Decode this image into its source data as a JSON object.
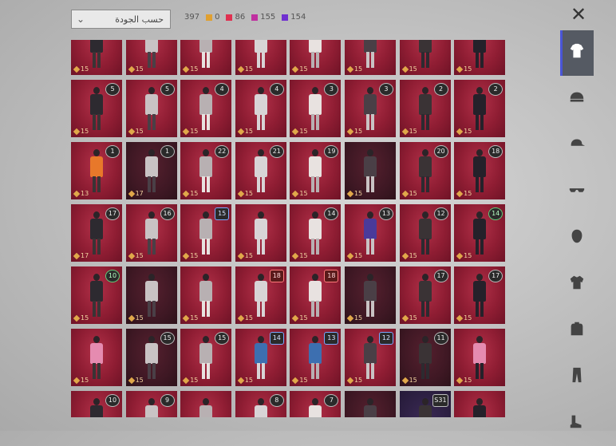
{
  "header": {
    "sort_label": "حسب الجودة",
    "total": "397",
    "quality_counts": [
      {
        "value": "0",
        "color": "#e0a030"
      },
      {
        "value": "86",
        "color": "#e03050"
      },
      {
        "value": "155",
        "color": "#c030a0"
      },
      {
        "value": "154",
        "color": "#7030d0"
      }
    ]
  },
  "sidebar": {
    "categories": [
      {
        "icon": "outfit-icon",
        "active": true
      },
      {
        "icon": "helmet-icon",
        "active": false
      },
      {
        "icon": "cap-icon",
        "active": false
      },
      {
        "icon": "glasses-icon",
        "active": false
      },
      {
        "icon": "mask-icon",
        "active": false
      },
      {
        "icon": "jacket-icon",
        "active": false
      },
      {
        "icon": "backpack-icon",
        "active": false
      },
      {
        "icon": "pants-icon",
        "active": false
      },
      {
        "icon": "shoes-icon",
        "active": false
      }
    ]
  },
  "items": [
    {
      "badge": "",
      "price": "15"
    },
    {
      "badge": "",
      "price": "15"
    },
    {
      "badge": "",
      "price": "15"
    },
    {
      "badge": "",
      "price": "15"
    },
    {
      "badge": "",
      "price": "15"
    },
    {
      "badge": "",
      "price": "15"
    },
    {
      "badge": "",
      "price": "15"
    },
    {
      "badge": "",
      "price": "15"
    },
    {
      "badge": "5",
      "price": "15"
    },
    {
      "badge": "5",
      "price": "15"
    },
    {
      "badge": "4",
      "price": "15"
    },
    {
      "badge": "4",
      "price": "15"
    },
    {
      "badge": "3",
      "price": "15"
    },
    {
      "badge": "3",
      "price": "15"
    },
    {
      "badge": "2",
      "price": "15"
    },
    {
      "badge": "2",
      "price": "15"
    },
    {
      "badge": "1",
      "price": "13"
    },
    {
      "badge": "1",
      "price": "17"
    },
    {
      "badge": "22",
      "price": "15"
    },
    {
      "badge": "21",
      "price": "15"
    },
    {
      "badge": "19",
      "price": "15"
    },
    {
      "badge": "",
      "price": "15"
    },
    {
      "badge": "20",
      "price": "15"
    },
    {
      "badge": "18",
      "price": "15"
    },
    {
      "badge": "17",
      "price": "17"
    },
    {
      "badge": "16",
      "price": "15"
    },
    {
      "badge": "15",
      "price": "15"
    },
    {
      "badge": "",
      "price": "15"
    },
    {
      "badge": "14",
      "price": "15"
    },
    {
      "badge": "13",
      "price": "15"
    },
    {
      "badge": "12",
      "price": "15"
    },
    {
      "badge": "14",
      "price": "15"
    },
    {
      "badge": "10",
      "price": "15"
    },
    {
      "badge": "",
      "price": "15"
    },
    {
      "badge": "",
      "price": "15"
    },
    {
      "badge": "18",
      "price": "15"
    },
    {
      "badge": "18",
      "price": "15"
    },
    {
      "badge": "",
      "price": "15"
    },
    {
      "badge": "17",
      "price": "15"
    },
    {
      "badge": "17",
      "price": "15"
    },
    {
      "badge": "",
      "price": "15"
    },
    {
      "badge": "15",
      "price": "15"
    },
    {
      "badge": "15",
      "price": "15"
    },
    {
      "badge": "14",
      "price": "15"
    },
    {
      "badge": "13",
      "price": "15"
    },
    {
      "badge": "12",
      "price": "15"
    },
    {
      "badge": "11",
      "price": "15"
    },
    {
      "badge": "",
      "price": "15"
    },
    {
      "badge": "10",
      "price": ""
    },
    {
      "badge": "9",
      "price": ""
    },
    {
      "badge": "",
      "price": ""
    },
    {
      "badge": "8",
      "price": ""
    },
    {
      "badge": "7",
      "price": ""
    },
    {
      "badge": "",
      "price": ""
    },
    {
      "badge": "S31",
      "price": ""
    },
    {
      "badge": "",
      "price": ""
    }
  ]
}
